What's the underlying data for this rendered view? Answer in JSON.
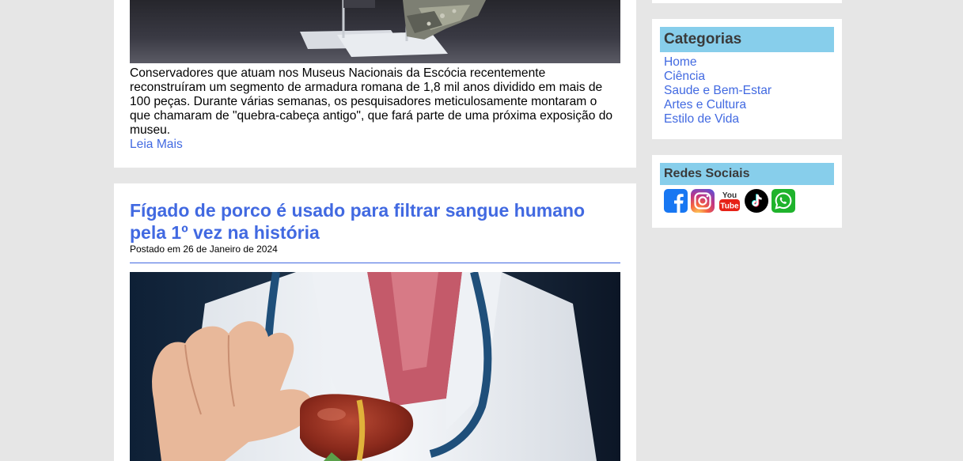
{
  "posts": [
    {
      "excerpt": "Conservadores que atuam nos Museus Nacionais da Escócia recentemente reconstruíram um segmento de armadura romana de 1,8 mil anos dividido em mais de 100 peças. Durante várias semanas, os pesquisadores meticulosamente montaram o que chamaram de \"quebra-cabeça antigo\", que fará parte de uma próxima exposição do museu.",
      "read_more": "Leia Mais"
    },
    {
      "title": "Fígado de porco é usado para filtrar sangue humano pela 1º vez na história",
      "date": "Postado em 26 de Janeiro de 2024"
    }
  ],
  "sidebar": {
    "categories": {
      "title": "Categorias",
      "items": [
        "Home",
        "Ciência",
        "Saude e Bem-Estar",
        "Artes e Cultura",
        "Estilo de Vida"
      ]
    },
    "social": {
      "title": "Redes Sociais",
      "icons": [
        "facebook-icon",
        "instagram-icon",
        "youtube-icon",
        "tiktok-icon",
        "whatsapp-icon"
      ],
      "youtube_text": [
        "You",
        "Tube"
      ]
    }
  },
  "colors": {
    "link": "#4169e1",
    "widget_header": "#87ceeb",
    "page_background": "#e6e6e6"
  }
}
